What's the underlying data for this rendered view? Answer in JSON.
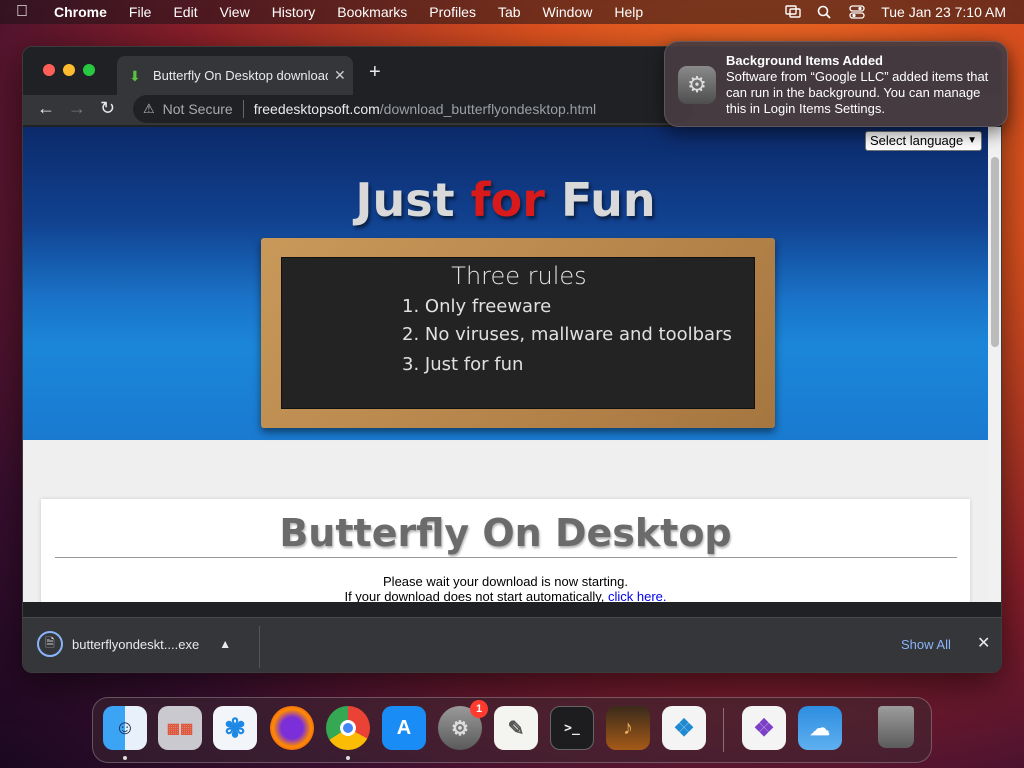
{
  "menubar": {
    "app": "Chrome",
    "items": [
      "File",
      "Edit",
      "View",
      "History",
      "Bookmarks",
      "Profiles",
      "Tab",
      "Window",
      "Help"
    ],
    "datetime": "Tue Jan 23  7:10 AM"
  },
  "browser": {
    "tab_title": "Butterfly On Desktop download",
    "not_secure": "Not Secure",
    "url_domain": "freedesktopsoft.com",
    "url_path": "/download_butterflyondesktop.html"
  },
  "page": {
    "language_select": "Select language",
    "hero_title_part1": "Just ",
    "hero_title_part2": "for",
    "hero_title_part3": " Fun",
    "board_title": "Three rules",
    "rules": [
      "1. Only freeware",
      "2. No viruses, mallware and toolbars",
      "3. Just for fun"
    ],
    "heading": "Butterfly On Desktop",
    "wait_text": "Please wait your download is now starting.",
    "fallback_text": "If your download does not start automatically,",
    "fallback_link": "click here."
  },
  "downloads": {
    "filename": "butterflyondeskt....exe",
    "show_all": "Show All"
  },
  "notification": {
    "title": "Background Items Added",
    "body": "Software from “Google LLC” added items that can run in the background. You can manage this in Login Items Settings."
  },
  "dock": {
    "apps": [
      "finder",
      "launchpad",
      "safari",
      "firefox",
      "chrome",
      "app-store",
      "system-settings",
      "textedit",
      "terminal",
      "garageband",
      "vscode",
      "visual-studio",
      "weather",
      "trash"
    ],
    "settings_badge": "1"
  },
  "colors": {
    "accent_red": "#d81a1a",
    "link": "#0000ee",
    "download_link": "#8ab4f8"
  }
}
